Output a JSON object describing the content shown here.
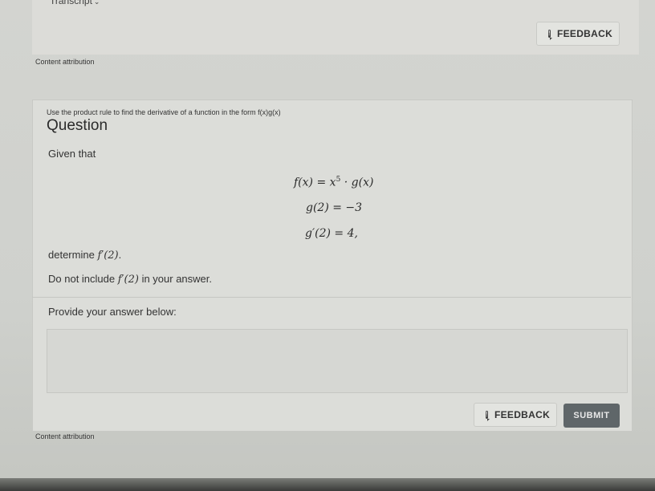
{
  "top": {
    "transcript_label": "Transcript",
    "feedback_label": "FEEDBACK",
    "attribution": "Content attribution"
  },
  "question": {
    "instruction": "Use the product rule to find the derivative of a function in the form f(x)g(x)",
    "title": "Question",
    "given": "Given that",
    "eq1_lhs": "f(x)",
    "eq1_rhs_base": "x",
    "eq1_rhs_exp": "5",
    "eq1_rhs_tail": "· g(x)",
    "eq2": "g(2) = −3",
    "eq3": "g′(2) = 4,",
    "determine_prefix": "determine",
    "determine_math": "f′(2)",
    "determine_suffix": ".",
    "note_prefix": "Do not include",
    "note_math": "f′(2)",
    "note_suffix": "in your answer."
  },
  "answer": {
    "label": "Provide your answer below:",
    "value": ""
  },
  "bottom": {
    "feedback_label": "FEEDBACK",
    "submit_label": "SUBMIT",
    "attribution": "Content attribution"
  }
}
